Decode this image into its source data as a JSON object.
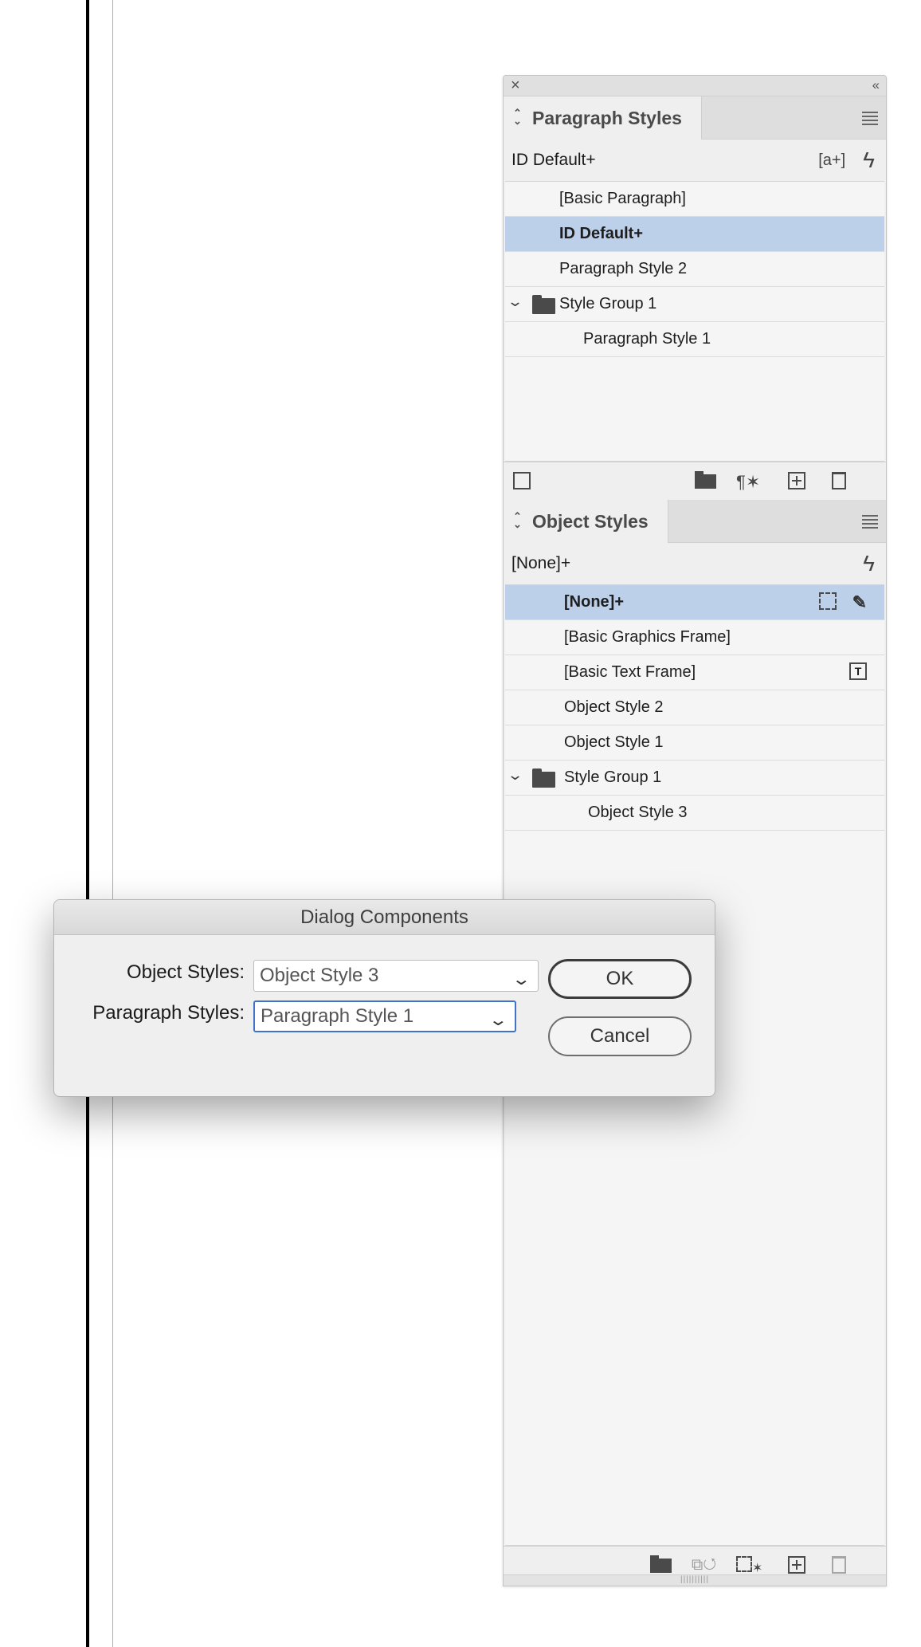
{
  "paragraph_panel": {
    "title": "Paragraph Styles",
    "current": "ID Default+",
    "items": [
      {
        "label": "[Basic Paragraph]",
        "selected": false,
        "indent": 1
      },
      {
        "label": "ID Default+",
        "selected": true,
        "indent": 1
      },
      {
        "label": "Paragraph Style 2",
        "selected": false,
        "indent": 1
      },
      {
        "label": "Style Group 1",
        "selected": false,
        "indent": 1,
        "group": true
      },
      {
        "label": "Paragraph Style 1",
        "selected": false,
        "indent": 2
      }
    ]
  },
  "object_panel": {
    "title": "Object Styles",
    "current": "[None]+",
    "items": [
      {
        "label": "[None]+",
        "selected": true,
        "indent": 1
      },
      {
        "label": "[Basic Graphics Frame]",
        "selected": false,
        "indent": 1
      },
      {
        "label": "[Basic Text Frame]",
        "selected": false,
        "indent": 1
      },
      {
        "label": "Object Style 2",
        "selected": false,
        "indent": 1
      },
      {
        "label": "Object Style 1",
        "selected": false,
        "indent": 1
      },
      {
        "label": "Style Group 1",
        "selected": false,
        "indent": 1,
        "group": true
      },
      {
        "label": "Object Style 3",
        "selected": false,
        "indent": 2
      }
    ]
  },
  "dialog": {
    "title": "Dialog Components",
    "object_label": "Object Styles:",
    "object_value": "Object Style 3",
    "paragraph_label": "Paragraph Styles:",
    "paragraph_value": "Paragraph Style 1",
    "ok_label": "OK",
    "cancel_label": "Cancel"
  },
  "colors": {
    "selection": "#bdd0ea",
    "focus": "#3f72c8",
    "margin": "#e9909c"
  }
}
